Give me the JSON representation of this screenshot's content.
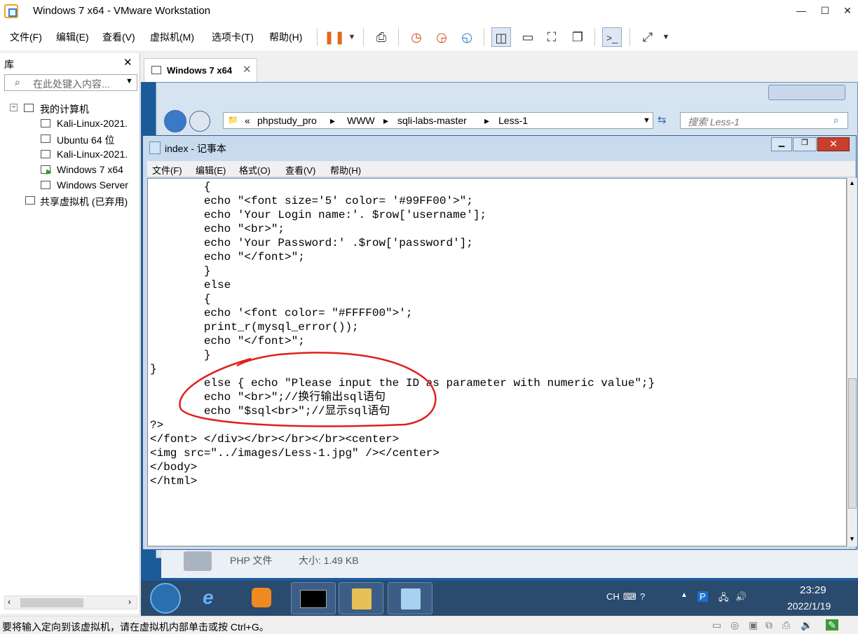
{
  "vm": {
    "title": "Windows 7 x64 - VMware Workstation",
    "menu": [
      "文件(F)",
      "编辑(E)",
      "查看(V)",
      "虚拟机(M)",
      "选项卡(T)",
      "帮助(H)"
    ],
    "window_controls": {
      "minimize": "—",
      "maximize": "☐",
      "close": "✕"
    }
  },
  "library": {
    "title": "库",
    "close": "✕",
    "search_placeholder": "在此处键入内容...",
    "tree": [
      {
        "label": "我的计算机",
        "level": 0
      },
      {
        "label": "Kali-Linux-2021.",
        "level": 1
      },
      {
        "label": "Ubuntu 64 位",
        "level": 1
      },
      {
        "label": "Kali-Linux-2021.",
        "level": 1
      },
      {
        "label": "Windows 7 x64",
        "level": 1
      },
      {
        "label": "Windows Server",
        "level": 1
      },
      {
        "label": "共享虚拟机 (已弃用)",
        "level": 0
      }
    ]
  },
  "tab": {
    "label": "Windows 7 x64",
    "close": "✕"
  },
  "explorer": {
    "breadcrumb": [
      "«",
      "phpstudy_pro",
      "WWW",
      "sqli-labs-master",
      "Less-1"
    ],
    "search_placeholder": "搜索 Less-1",
    "details": {
      "type": "PHP 文件",
      "size": "大小: 1.49 KB"
    }
  },
  "notepad": {
    "title": "index - 记事本",
    "menu": [
      "文件(F)",
      "编辑(E)",
      "格式(O)",
      "查看(V)",
      "帮助(H)"
    ],
    "lines": [
      "\t{",
      "\techo \"<font size='5' color= '#99FF00'>\";",
      "\techo 'Your Login name:'. $row['username'];",
      "\techo \"<br>\";",
      "\techo 'Your Password:' .$row['password'];",
      "\techo \"</font>\";",
      "\t}",
      "\telse",
      "\t{",
      "\techo '<font color= \"#FFFF00\">';",
      "\tprint_r(mysql_error());",
      "\techo \"</font>\";",
      "\t}",
      "}",
      "\telse { echo \"Please input the ID as parameter with numeric value\";}",
      "\techo \"<br>\";//换行输出sql语句",
      "\techo \"$sql<br>\";//显示sql语句",
      "?>",
      "</font> </div></br></br></br><center>",
      "<img src=\"../images/Less-1.jpg\" /></center>",
      "</body>",
      "</html>"
    ]
  },
  "taskbar": {
    "tray_lang": "CH",
    "time": "23:29",
    "date": "2022/1/19"
  },
  "status": {
    "message": "要将输入定向到该虚拟机，请在虚拟机内部单击或按 Ctrl+G。"
  },
  "colors": {
    "annotation": "#e0201c",
    "guest_bg": "#1c5b9a"
  }
}
